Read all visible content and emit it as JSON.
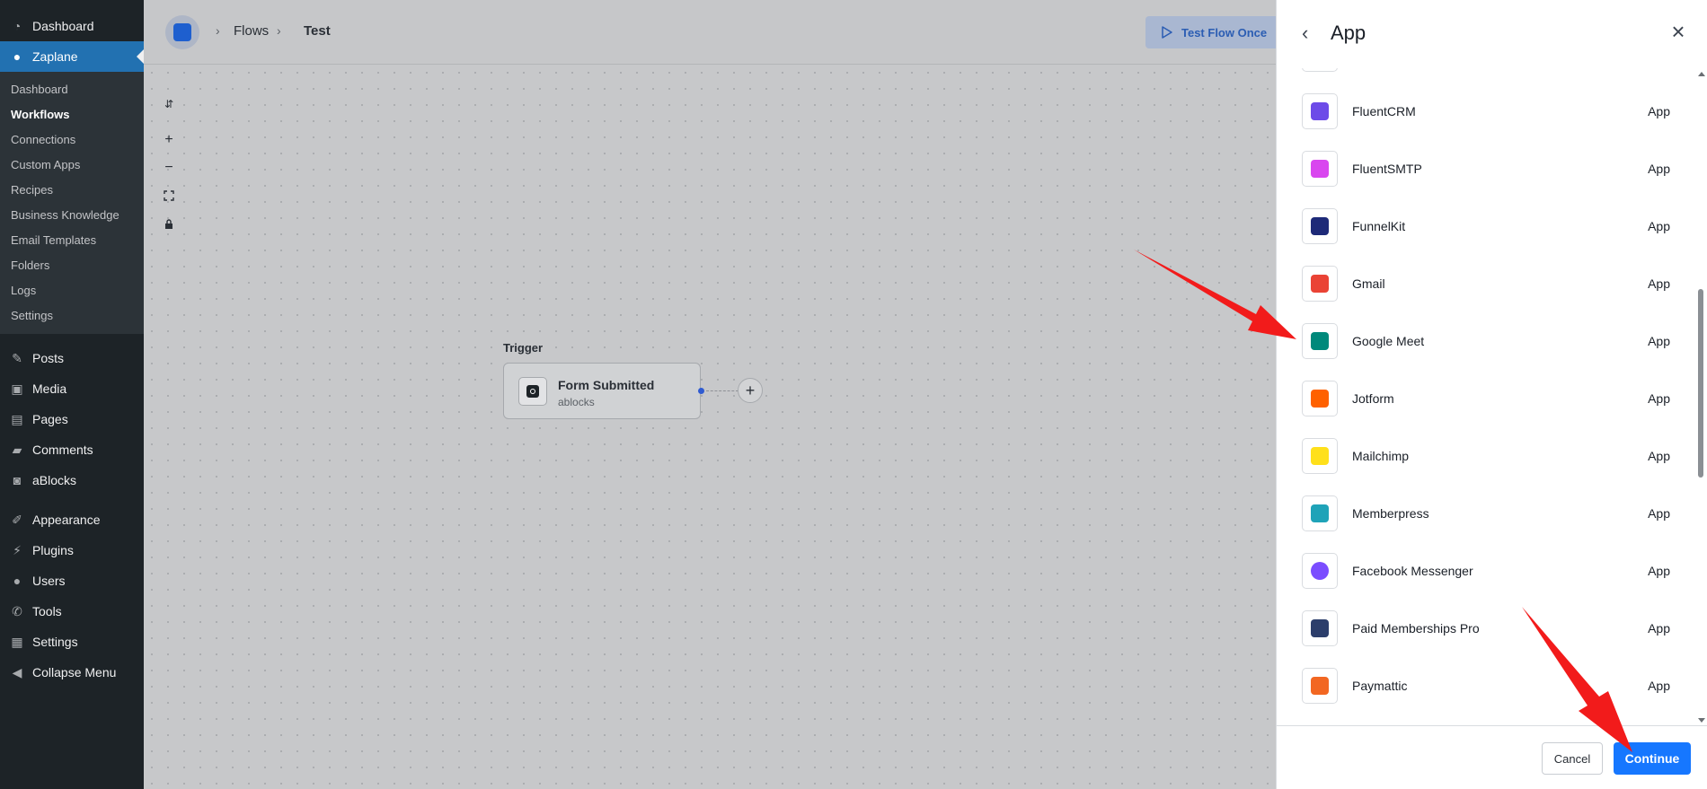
{
  "wp_sidebar": {
    "top_items": [
      {
        "label": "Dashboard",
        "icon": "dashboard-icon"
      },
      {
        "label": "Zaplane",
        "icon": "zaplane-icon"
      }
    ],
    "zaplane_submenu": [
      "Dashboard",
      "Workflows",
      "Connections",
      "Custom Apps",
      "Recipes",
      "Business Knowledge",
      "Email Templates",
      "Folders",
      "Logs",
      "Settings"
    ],
    "items": [
      {
        "label": "Posts",
        "icon": "pin-icon"
      },
      {
        "label": "Media",
        "icon": "media-icon"
      },
      {
        "label": "Pages",
        "icon": "pages-icon"
      },
      {
        "label": "Comments",
        "icon": "comment-icon"
      },
      {
        "label": "aBlocks",
        "icon": "ablocks-icon"
      },
      {
        "label": "Appearance",
        "icon": "brush-icon"
      },
      {
        "label": "Plugins",
        "icon": "plug-icon"
      },
      {
        "label": "Users",
        "icon": "user-icon"
      },
      {
        "label": "Tools",
        "icon": "wrench-icon"
      },
      {
        "label": "Settings",
        "icon": "sliders-icon"
      },
      {
        "label": "Collapse Menu",
        "icon": "collapse-icon"
      }
    ]
  },
  "topbar": {
    "breadcrumb": [
      "Flows",
      "Test"
    ],
    "test_flow_button": "Test Flow Once"
  },
  "canvas": {
    "trigger_label": "Trigger",
    "node_title": "Form Submitted",
    "node_subtitle": "ablocks"
  },
  "panel": {
    "title": "App",
    "apps": [
      {
        "name": "FluentCRM",
        "type": "App",
        "color": "#6d4be8"
      },
      {
        "name": "FluentSMTP",
        "type": "App",
        "color": "#d946ef"
      },
      {
        "name": "FunnelKit",
        "type": "App",
        "color": "#1e2a78"
      },
      {
        "name": "Gmail",
        "type": "App",
        "color": "#ea4335"
      },
      {
        "name": "Google Meet",
        "type": "App",
        "color": "#00897b"
      },
      {
        "name": "Jotform",
        "type": "App",
        "color": "#ff6100"
      },
      {
        "name": "Mailchimp",
        "type": "App",
        "color": "#ffe01b"
      },
      {
        "name": "Memberpress",
        "type": "App",
        "color": "#1fa3b8"
      },
      {
        "name": "Facebook Messenger",
        "type": "App",
        "color": "#7b4dff"
      },
      {
        "name": "Paid Memberships Pro",
        "type": "App",
        "color": "#2c3e6b"
      },
      {
        "name": "Paymattic",
        "type": "App",
        "color": "#f26722"
      }
    ],
    "cancel_label": "Cancel",
    "continue_label": "Continue"
  }
}
